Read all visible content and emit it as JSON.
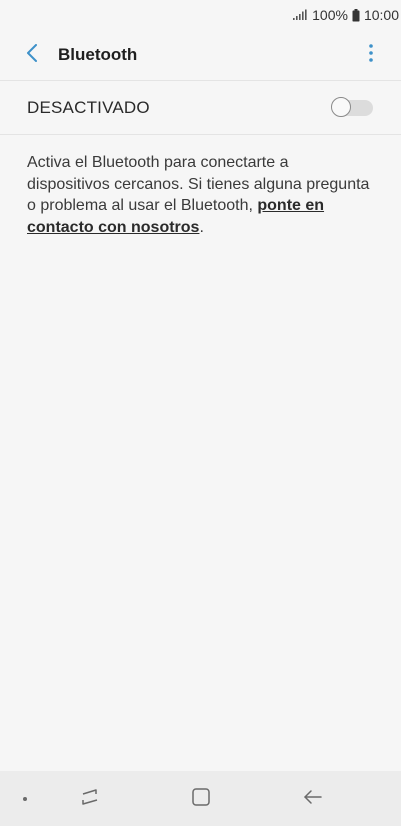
{
  "status_bar": {
    "signal_icon": "signal-bars-icon",
    "battery_percent": "100%",
    "battery_icon": "battery-icon",
    "time": "10:00"
  },
  "app_bar": {
    "back_icon": "back-arrow-icon",
    "title": "Bluetooth",
    "more_icon": "more-vertical-icon"
  },
  "toggle": {
    "label": "DESACTIVADO",
    "state": "off"
  },
  "description": {
    "text": "Activa el Bluetooth para conectarte a dispositivos cercanos. Si tienes alguna pregunta o problema al usar el Bluetooth,",
    "link_text": "ponte en contacto con nosotros",
    "trailing": "."
  },
  "nav_bar": {
    "recents_icon": "recent-apps-icon",
    "home_icon": "home-icon",
    "back_icon": "back-arrow-icon"
  },
  "colors": {
    "accent": "#3e91c9",
    "background": "#f6f6f6",
    "nav_bar": "#ececec"
  }
}
